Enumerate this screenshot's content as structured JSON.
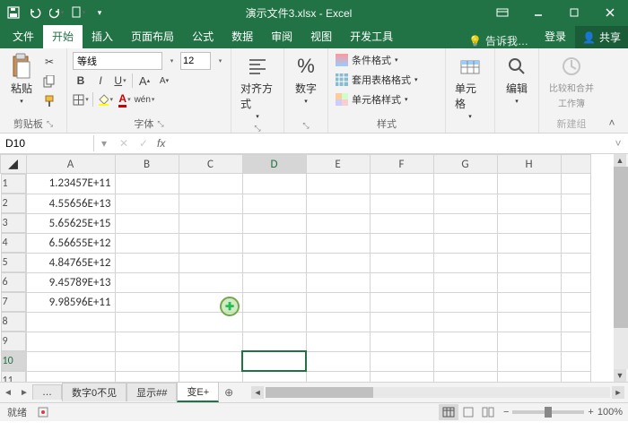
{
  "title": "演示文件3.xlsx - Excel",
  "tabs": {
    "file": "文件",
    "home": "开始",
    "insert": "插入",
    "layout": "页面布局",
    "formulas": "公式",
    "data": "数据",
    "review": "审阅",
    "view": "视图",
    "dev": "开发工具",
    "tellme": "告诉我…",
    "login": "登录",
    "share": "共享"
  },
  "ribbon": {
    "clipboard": {
      "paste": "粘贴",
      "label": "剪贴板"
    },
    "font": {
      "name": "等线",
      "size": "12",
      "label": "字体",
      "wen": "wén"
    },
    "align": {
      "label": "对齐方式"
    },
    "number": {
      "label": "数字",
      "pct": "%"
    },
    "styles": {
      "cond": "条件格式",
      "table": "套用表格格式",
      "cell": "单元格样式",
      "label": "样式"
    },
    "cells": {
      "label": "单元格"
    },
    "edit": {
      "label": "编辑"
    },
    "compare": {
      "l1": "比较和合并",
      "l2": "工作簿",
      "label": "新建组"
    }
  },
  "namebox": "D10",
  "fx": "fx",
  "cols": [
    "A",
    "B",
    "C",
    "D",
    "E",
    "F",
    "G",
    "H"
  ],
  "rows": [
    "1",
    "2",
    "3",
    "4",
    "5",
    "6",
    "7",
    "8",
    "9",
    "10",
    "11"
  ],
  "dataA": [
    "1.23457E+11",
    "4.55656E+13",
    "5.65625E+15",
    "6.56655E+12",
    "4.84765E+12",
    "9.45789E+13",
    "9.98596E+11"
  ],
  "selected": {
    "col": "D",
    "row": "10"
  },
  "sheets": {
    "dots": "…",
    "s1": "数字0不见",
    "s2": "显示##",
    "s3": "变E+"
  },
  "status": {
    "ready": "就绪",
    "rec": "",
    "zoom": "100%"
  }
}
